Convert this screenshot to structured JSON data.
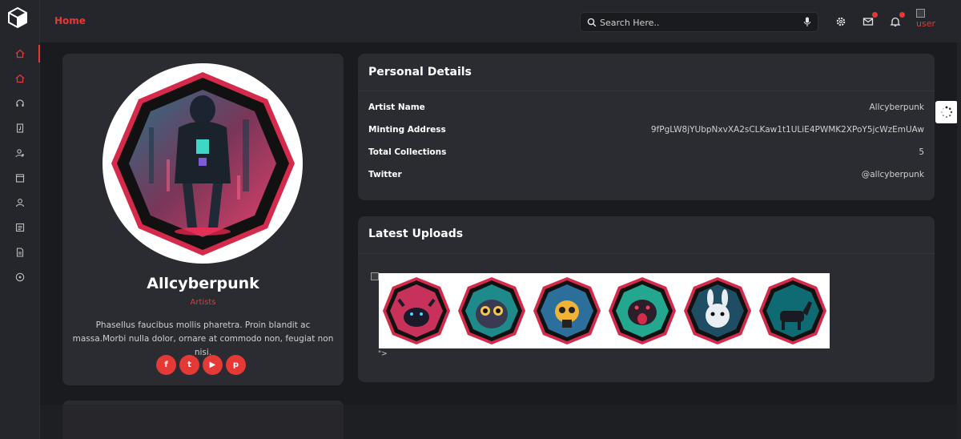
{
  "topbar": {
    "home_label": "Home",
    "search_placeholder": "Search Here..",
    "user_alt": "user"
  },
  "sidebar": {
    "items": [
      {
        "icon": "home-icon"
      },
      {
        "icon": "home-icon"
      },
      {
        "icon": "headphones-icon"
      },
      {
        "icon": "music-file-icon"
      },
      {
        "icon": "user-settings-icon"
      },
      {
        "icon": "calendar-icon"
      },
      {
        "icon": "user-icon"
      },
      {
        "icon": "list-icon"
      },
      {
        "icon": "document-icon"
      },
      {
        "icon": "disc-icon"
      }
    ]
  },
  "profile": {
    "name": "Allcyberpunk",
    "role": "Artists",
    "bio": "Phasellus faucibus mollis pharetra. Proin blandit ac massa.Morbi nulla dolor, ornare at commodo non, feugiat non nisi.",
    "socials": [
      {
        "icon": "facebook-icon",
        "glyph": "f"
      },
      {
        "icon": "twitter-icon",
        "glyph": "t"
      },
      {
        "icon": "youtube-icon",
        "glyph": "▶"
      },
      {
        "icon": "pinterest-icon",
        "glyph": "p"
      }
    ]
  },
  "personal_details": {
    "title": "Personal Details",
    "rows": [
      {
        "label": "Artist Name",
        "value": "Allcyberpunk"
      },
      {
        "label": "Minting Address",
        "value": "9fPgLW8jYUbpNxvXA2sCLKaw1t1ULiE4PWMK2XPoY5jcWzEmUAw"
      },
      {
        "label": "Total Collections",
        "value": "5"
      },
      {
        "label": "Twitter",
        "value": "@allcyberpunk"
      }
    ]
  },
  "latest_uploads": {
    "title": "Latest Uploads",
    "stray_text": "\">",
    "items": [
      {
        "name": "bull-nft",
        "bg": "#c8325a"
      },
      {
        "name": "owl-nft",
        "bg": "#1f8a8a"
      },
      {
        "name": "bee-nft",
        "bg": "#2c6f9c"
      },
      {
        "name": "rat-nft",
        "bg": "#23a88f"
      },
      {
        "name": "rabbit-nft",
        "bg": "#1f4d63"
      },
      {
        "name": "donkey-nft",
        "bg": "#0f6b73"
      }
    ]
  },
  "colors": {
    "accent": "#e53935",
    "background": "#1a1b1e",
    "card": "#2a2c31"
  }
}
